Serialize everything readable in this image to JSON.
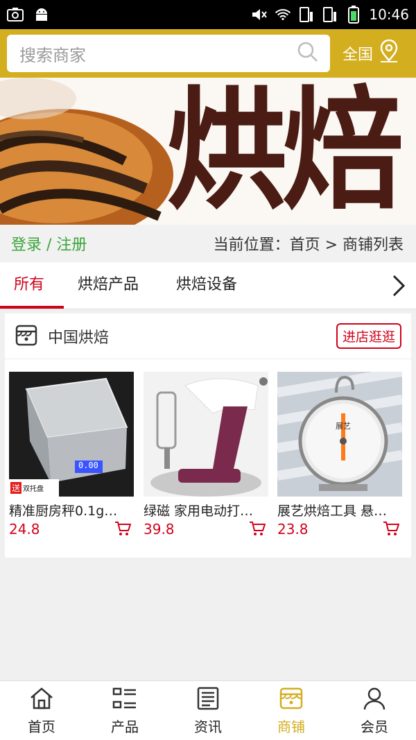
{
  "status_bar": {
    "time": "10:46"
  },
  "header": {
    "search_placeholder": "搜索商家",
    "region": "全国"
  },
  "banner": {
    "text": "烘焙"
  },
  "breadcrumb": {
    "login": "登录 / 注册",
    "current": "当前位置：首页 > 商铺列表"
  },
  "tabs": [
    {
      "label": "所有",
      "active": true
    },
    {
      "label": "烘焙产品",
      "active": false
    },
    {
      "label": "烘焙设备",
      "active": false
    }
  ],
  "shop": {
    "name": "中国烘焙",
    "visit_label": "进店逛逛",
    "products": [
      {
        "name": "精准厨房秤0.1g…",
        "price": "24.8",
        "badge": "送",
        "badge_text": "双托盘",
        "scale_reading": "0.00"
      },
      {
        "name": "绿磁 家用电动打…",
        "price": "39.8"
      },
      {
        "name": "展艺烘焙工具 悬…",
        "price": "23.8",
        "dial_brand": "展艺"
      }
    ]
  },
  "bottom_nav": [
    {
      "label": "首页",
      "icon": "home-icon",
      "active": false
    },
    {
      "label": "产品",
      "icon": "list-icon",
      "active": false
    },
    {
      "label": "资讯",
      "icon": "news-icon",
      "active": false
    },
    {
      "label": "商铺",
      "icon": "store-icon",
      "active": true
    },
    {
      "label": "会员",
      "icon": "user-icon",
      "active": false
    }
  ],
  "colors": {
    "accent": "#d3ae1f",
    "price": "#d0021b",
    "login": "#3aa53a"
  }
}
